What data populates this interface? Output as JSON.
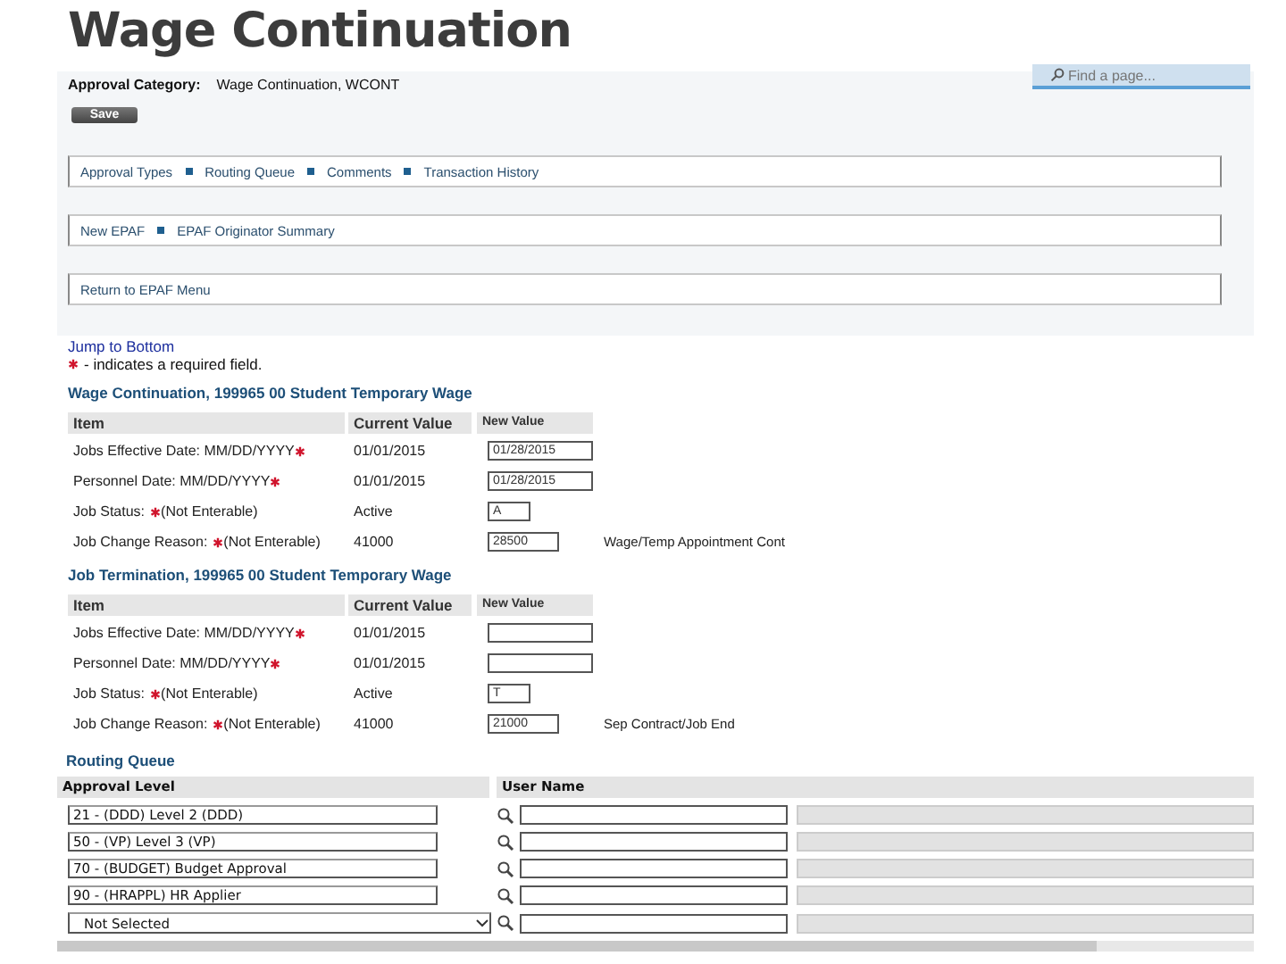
{
  "slide_title": "Wage Continuation",
  "search": {
    "placeholder": "Find a page..."
  },
  "approval_category": {
    "label": "Approval Category:",
    "value": "Wage Continuation, WCONT"
  },
  "save_button": "Save",
  "link_bars": [
    {
      "links": [
        "Approval Types",
        "Routing Queue",
        "Comments",
        "Transaction History"
      ]
    },
    {
      "links": [
        "New EPAF",
        "EPAF Originator Summary"
      ]
    },
    {
      "links": [
        "Return to EPAF Menu"
      ]
    }
  ],
  "jump_link": "Jump to Bottom",
  "required_note": {
    "text": "- indicates a required field."
  },
  "sections": [
    {
      "title": "Wage Continuation, 199965 00 Student Temporary Wage",
      "columns": [
        "Item",
        "Current Value",
        "New Value"
      ],
      "rows": [
        {
          "kind": "date",
          "label": "Jobs Effective Date: MM/DD/YYYY",
          "required": true,
          "current": "01/01/2015",
          "new_value": "01/28/2015"
        },
        {
          "kind": "date",
          "label": "Personnel Date: MM/DD/YYYY",
          "required": true,
          "current": "01/01/2015",
          "new_value": "01/28/2015"
        },
        {
          "kind": "status",
          "label": "Job Status:",
          "required": true,
          "note": "(Not Enterable)",
          "current": "Active",
          "new_value": "A"
        },
        {
          "kind": "reason",
          "label": "Job Change Reason:",
          "required": true,
          "note": "(Not Enterable)",
          "current": "41000",
          "new_value": "28500",
          "description": "Wage/Temp Appointment Cont"
        }
      ]
    },
    {
      "title": "Job Termination, 199965 00 Student Temporary Wage",
      "columns": [
        "Item",
        "Current Value",
        "New Value"
      ],
      "rows": [
        {
          "kind": "date",
          "label": "Jobs Effective Date: MM/DD/YYYY",
          "required": true,
          "current": "01/01/2015"
        },
        {
          "kind": "date",
          "label": "Personnel Date: MM/DD/YYYY",
          "required": true,
          "current": "01/01/2015"
        },
        {
          "kind": "status",
          "label": "Job Status:",
          "required": true,
          "note": "(Not Enterable)",
          "current": "Active",
          "new_value": "T"
        },
        {
          "kind": "reason",
          "label": "Job Change Reason:",
          "required": true,
          "note": "(Not Enterable)",
          "current": "41000",
          "new_value": "21000",
          "description": "Sep Contract/Job End"
        }
      ]
    }
  ],
  "routing_queue": {
    "title": "Routing Queue",
    "columns": [
      "Approval Level",
      "User Name"
    ],
    "rows": [
      {
        "kind": "fixed",
        "level": "21 - (DDD) Level 2 (DDD)"
      },
      {
        "kind": "fixed",
        "level": "50 - (VP) Level 3 (VP)"
      },
      {
        "kind": "fixed",
        "level": "70 - (BUDGET) Budget Approval"
      },
      {
        "kind": "fixed",
        "level": "90 - (HRAPPL) HR Applier"
      },
      {
        "kind": "select",
        "level": "Not Selected"
      }
    ]
  }
}
